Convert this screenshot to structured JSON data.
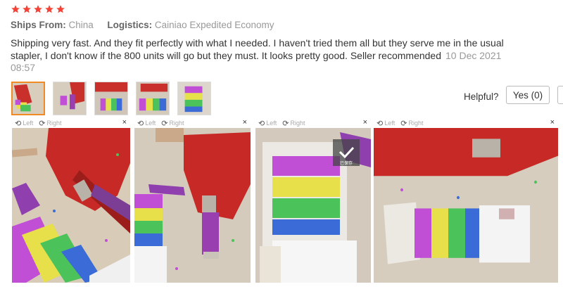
{
  "rating": {
    "stars": 5,
    "star_color": "#f44336"
  },
  "shipping": {
    "from_label": "Ships From:",
    "from_value": "China",
    "logistics_label": "Logistics:",
    "logistics_value": "Cainiao Expedited Economy"
  },
  "review": {
    "text": "Shipping very fast. And they fit perfectly with what I needed. I haven't tried them all but they serve me in the usual stapler, I don't know if the 800 units will go but they must. It looks pretty good. Seller recommended",
    "date": "10 Dec 2021 08:57"
  },
  "thumbnails": [
    {
      "name": "thumb-1",
      "active": true
    },
    {
      "name": "thumb-2",
      "active": false
    },
    {
      "name": "thumb-3",
      "active": false
    },
    {
      "name": "thumb-4",
      "active": false
    },
    {
      "name": "thumb-5",
      "active": false
    }
  ],
  "helpful": {
    "label": "Helpful?",
    "yes_label": "Yes (0)"
  },
  "viewer": {
    "left_label": "Left",
    "right_label": "Right",
    "close_glyph": "×",
    "saved_label": "已保存"
  },
  "colors": {
    "accent_orange": "#f08a24",
    "star_red": "#f44336",
    "text_gray": "#999"
  }
}
